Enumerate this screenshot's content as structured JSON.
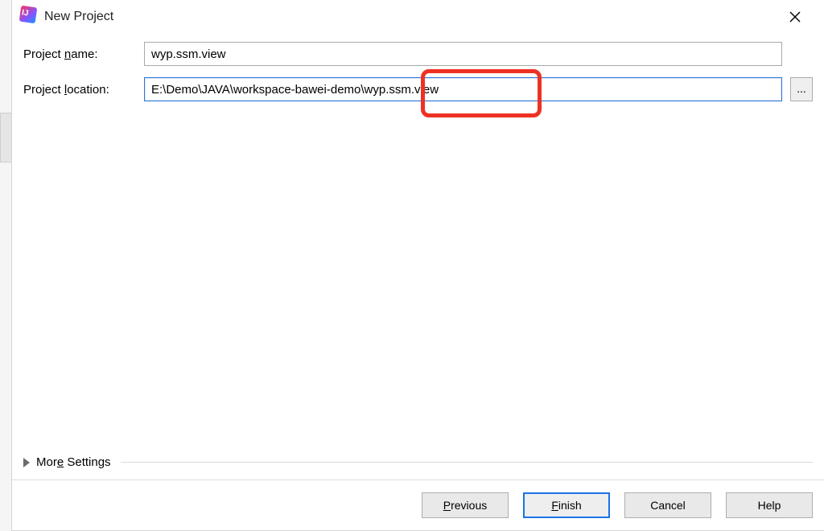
{
  "window": {
    "title": "New Project"
  },
  "fields": {
    "name_label_pre": "Project ",
    "name_label_mn": "n",
    "name_label_post": "ame:",
    "name_value": "wyp.ssm.view",
    "location_label_pre": "Project ",
    "location_label_mn": "l",
    "location_label_post": "ocation:",
    "location_value": "E:\\Demo\\JAVA\\workspace-bawei-demo\\wyp.ssm.view",
    "browse_label": "..."
  },
  "more": {
    "label_pre": "Mor",
    "label_mn": "e",
    "label_post": " Settings"
  },
  "buttons": {
    "previous_mn": "P",
    "previous_post": "revious",
    "finish_mn": "F",
    "finish_post": "inish",
    "cancel": "Cancel",
    "help": "Help"
  }
}
